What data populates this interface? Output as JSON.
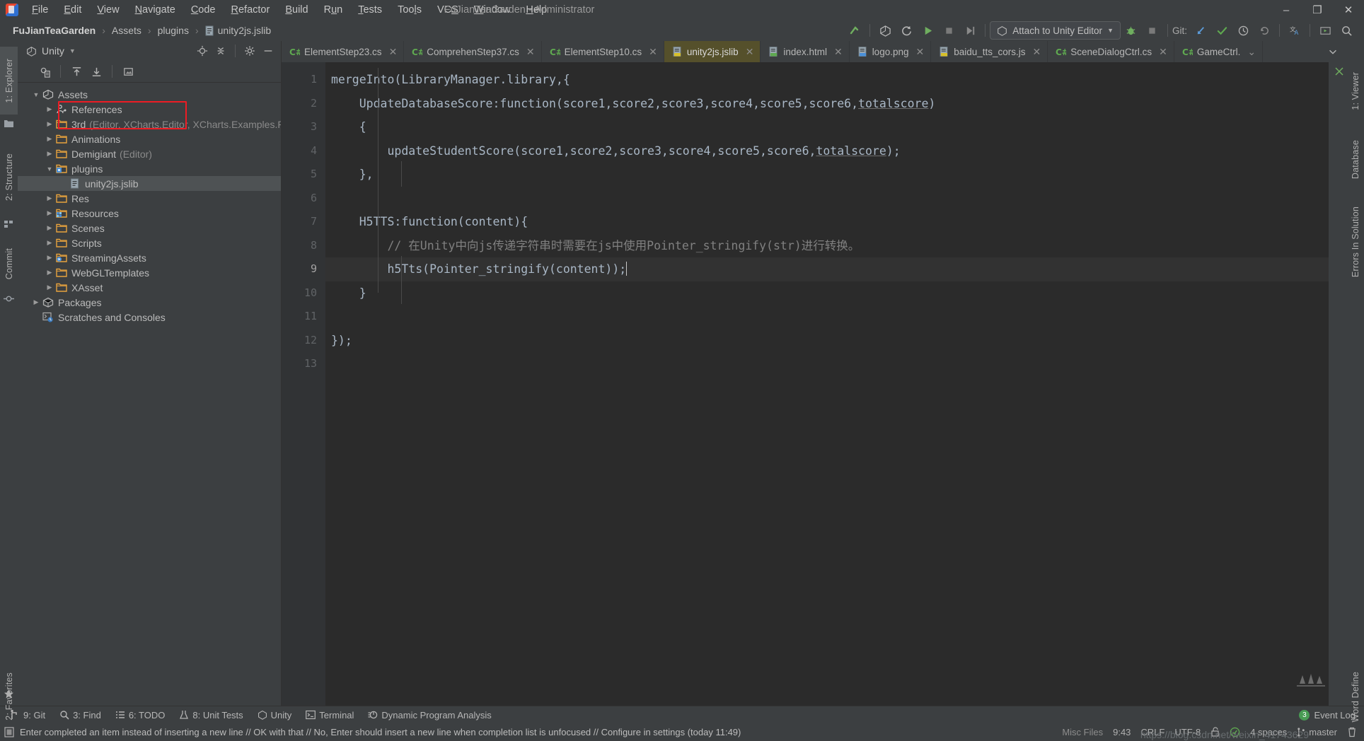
{
  "window": {
    "title": "FuJianTeaGarden - Administrator",
    "minimize": "–",
    "maximize": "❐",
    "close": "✕"
  },
  "menu": {
    "items": [
      {
        "label": "File"
      },
      {
        "label": "Edit"
      },
      {
        "label": "View"
      },
      {
        "label": "Navigate"
      },
      {
        "label": "Code"
      },
      {
        "label": "Refactor"
      },
      {
        "label": "Build"
      },
      {
        "label": "Run"
      },
      {
        "label": "Tests"
      },
      {
        "label": "Tools"
      },
      {
        "label": "VCS"
      },
      {
        "label": "Window"
      },
      {
        "label": "Help"
      }
    ]
  },
  "breadcrumb": {
    "project": "FuJianTeaGarden",
    "sep": "›",
    "items": [
      "Assets",
      "plugins"
    ],
    "file": "unity2js.jslib"
  },
  "toolbar": {
    "build_title": "Build",
    "unity_title": "Unity",
    "refresh_title": "Refresh",
    "run_title": "Run",
    "stop_title": "Stop",
    "step_title": "Step Over",
    "attach_label": "Attach to Unity Editor",
    "attach_caret": "▼",
    "debug_title": "Debug",
    "stop2_title": "Stop",
    "git_label": "Git:",
    "git_update_title": "Update Project",
    "git_commit_title": "Commit",
    "git_history_title": "History",
    "git_rollback_title": "Rollback",
    "translate_title": "Translate",
    "present_title": "Presentation",
    "search_title": "Search Everywhere"
  },
  "left_rail": {
    "explorer": "1: Explorer",
    "structure": "2: Structure",
    "commit": "Commit",
    "favorites": "2: Favorites"
  },
  "right_rail": {
    "viewer": "1: Viewer",
    "database": "Database",
    "errors": "Errors In Solution",
    "word": "Word Define"
  },
  "explorer": {
    "title": "Unity",
    "title_caret": "▼",
    "locate_title": "Select Opened File",
    "collapse_title": "Collapse All",
    "settings_title": "Options",
    "hide_title": "Hide",
    "toolbar": [
      {
        "name": "show-all-files-icon"
      },
      {
        "name": "upload-icon"
      },
      {
        "name": "download-icon"
      },
      {
        "name": "image-icon"
      }
    ],
    "tree": [
      {
        "indent": 0,
        "arrow": "▼",
        "icon": "unity",
        "label": "Assets",
        "dim": "",
        "selected": false
      },
      {
        "indent": 1,
        "arrow": "▶",
        "icon": "references",
        "label": "References",
        "dim": "",
        "selected": false
      },
      {
        "indent": 1,
        "arrow": "▶",
        "icon": "folder",
        "label": "3rd",
        "dim": "(Editor, XCharts.Editor, XCharts.Examples.Runtime, …)",
        "selected": false
      },
      {
        "indent": 1,
        "arrow": "▶",
        "icon": "folder",
        "label": "Animations",
        "dim": "",
        "selected": false
      },
      {
        "indent": 1,
        "arrow": "▶",
        "icon": "folder",
        "label": "Demigiant",
        "dim": "(Editor)",
        "selected": false
      },
      {
        "indent": 1,
        "arrow": "▼",
        "icon": "folder-plugin",
        "label": "plugins",
        "dim": "",
        "selected": false
      },
      {
        "indent": 2,
        "arrow": "",
        "icon": "file",
        "label": "unity2js.jslib",
        "dim": "",
        "selected": true
      },
      {
        "indent": 1,
        "arrow": "▶",
        "icon": "folder",
        "label": "Res",
        "dim": "",
        "selected": false
      },
      {
        "indent": 1,
        "arrow": "▶",
        "icon": "folder-res",
        "label": "Resources",
        "dim": "",
        "selected": false
      },
      {
        "indent": 1,
        "arrow": "▶",
        "icon": "folder",
        "label": "Scenes",
        "dim": "",
        "selected": false
      },
      {
        "indent": 1,
        "arrow": "▶",
        "icon": "folder",
        "label": "Scripts",
        "dim": "",
        "selected": false
      },
      {
        "indent": 1,
        "arrow": "▶",
        "icon": "folder-stream",
        "label": "StreamingAssets",
        "dim": "",
        "selected": false
      },
      {
        "indent": 1,
        "arrow": "▶",
        "icon": "folder",
        "label": "WebGLTemplates",
        "dim": "",
        "selected": false
      },
      {
        "indent": 1,
        "arrow": "▶",
        "icon": "folder",
        "label": "XAsset",
        "dim": "",
        "selected": false
      },
      {
        "indent": 0,
        "arrow": "▶",
        "icon": "package",
        "label": "Packages",
        "dim": "",
        "selected": false
      },
      {
        "indent": 0,
        "arrow": "",
        "icon": "scratch",
        "label": "Scratches and Consoles",
        "dim": "",
        "selected": false
      }
    ]
  },
  "editor_tabs": {
    "items": [
      {
        "label": "ElementStep23.cs",
        "icon": "cs",
        "active": false
      },
      {
        "label": "ComprehenStep37.cs",
        "icon": "cs",
        "active": false
      },
      {
        "label": "ElementStep10.cs",
        "icon": "cs",
        "active": false
      },
      {
        "label": "unity2js.jslib",
        "icon": "js",
        "active": true
      },
      {
        "label": "index.html",
        "icon": "html",
        "active": false
      },
      {
        "label": "logo.png",
        "icon": "png",
        "active": false
      },
      {
        "label": "baidu_tts_cors.js",
        "icon": "js",
        "active": false
      },
      {
        "label": "SceneDialogCtrl.cs",
        "icon": "cs",
        "active": false
      },
      {
        "label": "GameCtrl.",
        "icon": "cs",
        "active": false
      }
    ],
    "close_glyph": "✕",
    "overflow_glyph": "⌄"
  },
  "code": {
    "line_numbers": [
      "1",
      "2",
      "3",
      "4",
      "5",
      "6",
      "7",
      "8",
      "9",
      "10",
      "11",
      "12",
      "13"
    ],
    "current_line": 9,
    "lines": [
      "mergeInto(LibraryManager.library,{",
      "    UpdateDatabaseScore:function(score1,score2,score3,score4,score5,score6,totalscore)",
      "    {",
      "        updateStudentScore(score1,score2,score3,score4,score5,score6,totalscore);",
      "    },",
      "",
      "    H5TTS:function(content){",
      "        // 在Unity中向js传递字符串时需要在js中使用Pointer_stringify(str)进行转换。",
      "        h5Tts(Pointer_stringify(content));",
      "    }",
      "",
      "});",
      ""
    ]
  },
  "bottom_bar": {
    "items": [
      {
        "label": "9: Git",
        "icon": "git-icon"
      },
      {
        "label": "3: Find",
        "icon": "search-icon"
      },
      {
        "label": "6: TODO",
        "icon": "todo-icon"
      },
      {
        "label": "8: Unit Tests",
        "icon": "unit-tests-icon"
      },
      {
        "label": "Unity",
        "icon": "unity-icon"
      },
      {
        "label": "Terminal",
        "icon": "terminal-icon"
      },
      {
        "label": "Dynamic Program Analysis",
        "icon": "dpa-icon"
      }
    ],
    "event_log": "Event Log",
    "event_count": "3"
  },
  "status_bar": {
    "message": "Enter completed an item instead of inserting a new line // OK with that // No, Enter should insert a new line when completion list is unfocused // Configure in settings (today 11:49)",
    "file_type": "Misc Files",
    "caret": "9:43",
    "line_sep": "CRLF",
    "encoding": "UTF-8",
    "lock": "🔓",
    "indent": "4 spaces",
    "branch": "master",
    "watermark": "https://blog.csdn.net/weixin_41743629"
  },
  "colors": {
    "accent_green": "#499c54",
    "active_tab": "#55502b",
    "highlight_red": "#ed1c24",
    "folder_orange": "#e8a33d",
    "link_blue": "#589df6"
  }
}
